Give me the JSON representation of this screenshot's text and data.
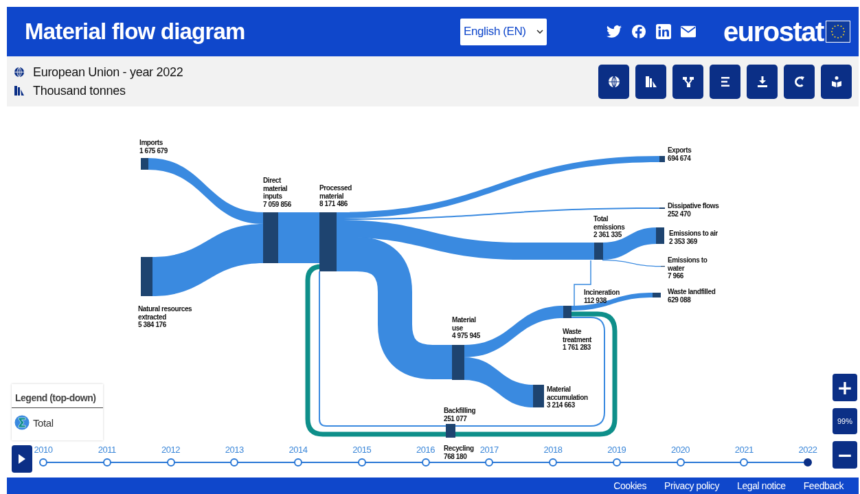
{
  "header": {
    "title": "Material flow diagram",
    "language": "English (EN)",
    "logo": "eurostat"
  },
  "info": {
    "region": "European Union - year 2022",
    "unit": "Thousand tonnes"
  },
  "toolbar": [
    {
      "kind": "globe"
    },
    {
      "kind": "units"
    },
    {
      "kind": "structure"
    },
    {
      "kind": "list"
    },
    {
      "kind": "download"
    },
    {
      "kind": "reset"
    },
    {
      "kind": "reader"
    }
  ],
  "nodes": [
    {
      "label": [
        "Imports"
      ],
      "value": "1 675 679"
    },
    {
      "label": [
        "Natural resources",
        "extracted"
      ],
      "value": "5 384 176"
    },
    {
      "label": [
        "Direct",
        "material",
        "inputs"
      ],
      "value": "7 059 856"
    },
    {
      "label": [
        "Processed",
        "material"
      ],
      "value": "8 171 486"
    },
    {
      "label": [
        "Exports"
      ],
      "value": "694 674"
    },
    {
      "label": [
        "Dissipative flows"
      ],
      "value": "252 470"
    },
    {
      "label": [
        "Total",
        "emissions"
      ],
      "value": "2 361 335"
    },
    {
      "label": [
        "Emissions to air"
      ],
      "value": "2 353 369"
    },
    {
      "label": [
        "Emissions to",
        "water"
      ],
      "value": "7 966"
    },
    {
      "label": [
        "Incineration"
      ],
      "value": "112 938"
    },
    {
      "label": [
        "Waste landfilled"
      ],
      "value": "629 088"
    },
    {
      "label": [
        "Material",
        "use"
      ],
      "value": "4 975 945"
    },
    {
      "label": [
        "Waste",
        "treatment"
      ],
      "value": "1 761 283"
    },
    {
      "label": [
        "Material",
        "accumulation"
      ],
      "value": "3 214 663"
    },
    {
      "label": [
        "Backfilling"
      ],
      "value": "251 077"
    },
    {
      "label": [
        "Recycling"
      ],
      "value": "768 180"
    }
  ],
  "legend": {
    "title": "Legend (top-down)",
    "items": [
      {
        "label": "Total"
      }
    ]
  },
  "timeline": [
    {
      "year": "2010",
      "selected": false
    },
    {
      "year": "2011",
      "selected": false
    },
    {
      "year": "2012",
      "selected": false
    },
    {
      "year": "2013",
      "selected": false
    },
    {
      "year": "2014",
      "selected": false
    },
    {
      "year": "2015",
      "selected": false
    },
    {
      "year": "2016",
      "selected": false
    },
    {
      "year": "2017",
      "selected": false
    },
    {
      "year": "2018",
      "selected": false
    },
    {
      "year": "2019",
      "selected": false
    },
    {
      "year": "2020",
      "selected": false
    },
    {
      "year": "2021",
      "selected": false
    },
    {
      "year": "2022",
      "selected": true
    }
  ],
  "zoom": {
    "plus": "+",
    "level": "99%",
    "minus": "−"
  },
  "footer": [
    "Cookies",
    "Privacy policy",
    "Legal notice",
    "Feedback"
  ]
}
